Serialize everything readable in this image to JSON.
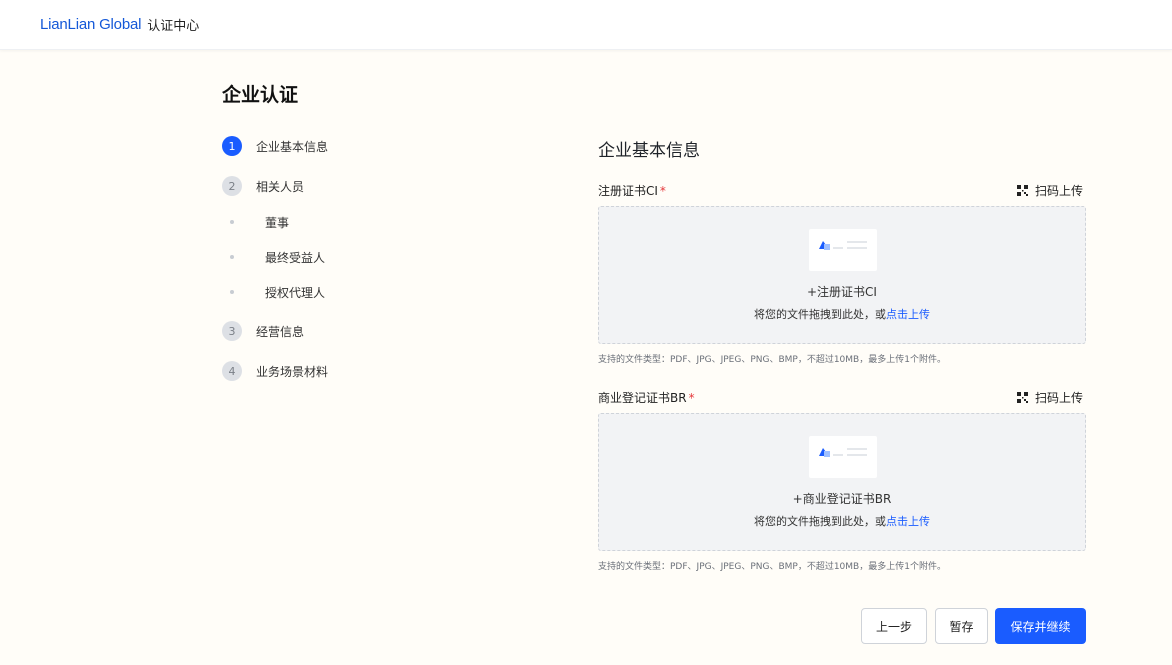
{
  "header": {
    "brand": "LianLian Global",
    "center_title": "认证中心"
  },
  "page_title": "企业认证",
  "steps": [
    {
      "number": "1",
      "label": "企业基本信息",
      "active": true
    },
    {
      "number": "2",
      "label": "相关人员"
    },
    {
      "number": "3",
      "label": "经营信息"
    },
    {
      "number": "4",
      "label": "业务场景材料"
    }
  ],
  "substeps": [
    "董事",
    "最终受益人",
    "授权代理人"
  ],
  "section_title": "企业基本信息",
  "uploads": [
    {
      "label": "注册证书CI",
      "required_mark": "*",
      "scan_label": "扫码上传",
      "add_text": "+注册证书CI",
      "drag_hint": "将您的文件拖拽到此处，或",
      "click_upload": "点击上传",
      "note": "支持的文件类型：PDF、JPG、JPEG、PNG、BMP，不超过10MB，最多上传1个附件。"
    },
    {
      "label": "商业登记证书BR",
      "required_mark": "*",
      "scan_label": "扫码上传",
      "add_text": "+商业登记证书BR",
      "drag_hint": "将您的文件拖拽到此处，或",
      "click_upload": "点击上传",
      "note": "支持的文件类型：PDF、JPG、JPEG、PNG、BMP，不超过10MB，最多上传1个附件。"
    }
  ],
  "buttons": {
    "prev": "上一步",
    "draft": "暂存",
    "save": "保存并继续"
  },
  "colors": {
    "primary": "#1a5cff",
    "brand": "#1458d8",
    "required": "#e5383b"
  }
}
